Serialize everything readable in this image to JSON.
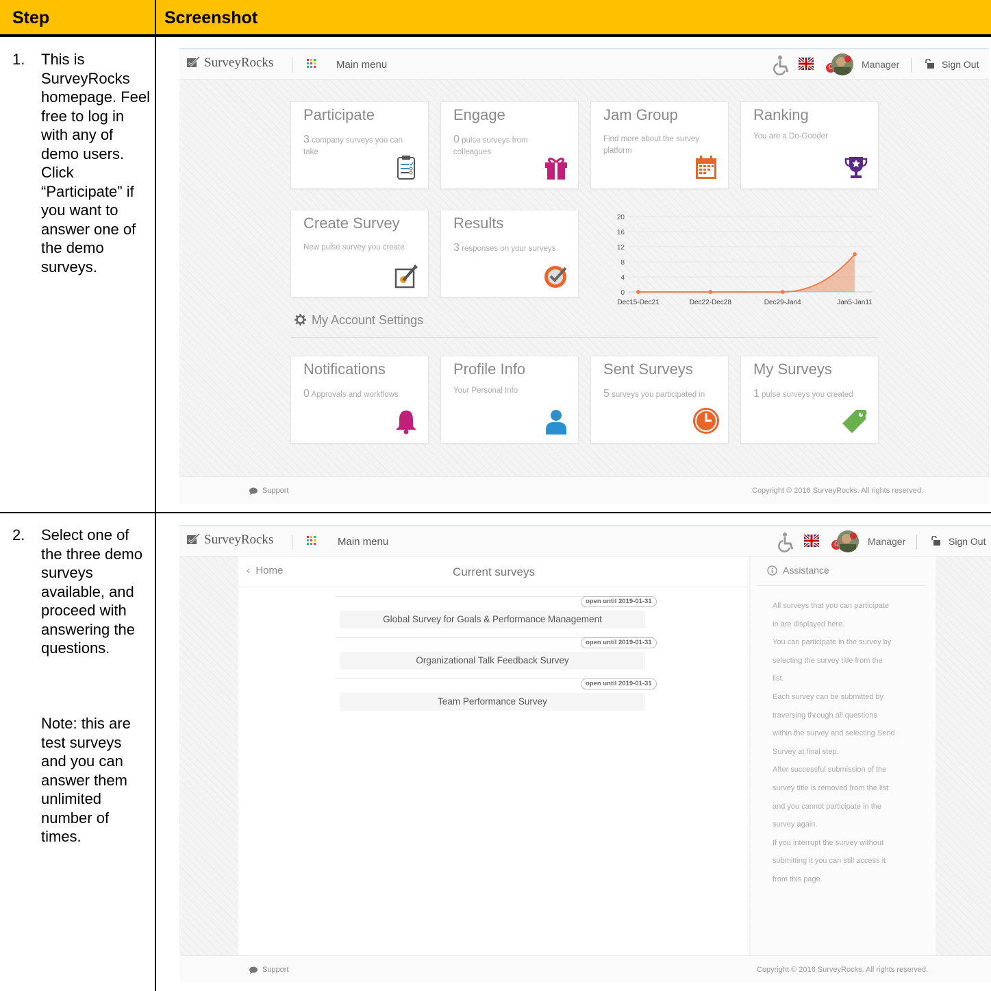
{
  "table": {
    "col_step": "Step",
    "col_screenshot": "Screenshot",
    "header_color": "#FFC000"
  },
  "steps": [
    {
      "number": "1.",
      "text": "This is SurveyRocks homepage. Feel free to log in with any of demo users. Click “Participate” if you want to answer one of the demo surveys."
    },
    {
      "number": "2.",
      "text": "Select one of the three demo surveys available, and proceed with answering the questions.",
      "note": "Note: this are test surveys and you can answer them unlimited number of times."
    }
  ],
  "app": {
    "brand": "SurveyRocks",
    "main_menu": "Main menu",
    "user": "Manager",
    "sign_out": "Sign Out",
    "notif_count": "0",
    "support": "Support",
    "copyright": "Copyright © 2016 SurveyRocks. All rights reserved.",
    "icons": [
      "brand-check-icon",
      "apps-grid-icon",
      "accessibility-icon",
      "uk-flag-icon",
      "avatar-icon",
      "sign-out-lock-icon",
      "support-chat-icon"
    ]
  },
  "home": {
    "tiles": [
      {
        "title": "Participate",
        "num": "3",
        "desc": "company surveys you can take",
        "icon": "clipboard-icon",
        "color": "#3a8fc8"
      },
      {
        "title": "Engage",
        "num": "0",
        "desc": "pulse surveys from colleagues",
        "icon": "gift-icon",
        "color": "#c0207a"
      },
      {
        "title": "Jam Group",
        "num": "",
        "desc": "Find more about the survey platform",
        "icon": "calendar-icon",
        "color": "#e8662a"
      },
      {
        "title": "Ranking",
        "num": "",
        "desc": "You are a Do-Gooder",
        "icon": "trophy-icon",
        "color": "#5b2a86"
      },
      {
        "title": "Create Survey",
        "num": "",
        "desc": "New pulse survey you create",
        "icon": "edit-icon",
        "color": "#e8a020"
      },
      {
        "title": "Results",
        "num": "3",
        "desc": "responses on your surveys",
        "icon": "check-circle-icon",
        "color": "#e8662a"
      }
    ],
    "account_heading": "My Account Settings",
    "account_tiles": [
      {
        "title": "Notifications",
        "num": "0",
        "desc": "Approvals and workflows",
        "icon": "bell-icon",
        "color": "#c0207a"
      },
      {
        "title": "Profile Info",
        "num": "",
        "desc": "Your Personal Info",
        "icon": "person-icon",
        "color": "#2a90d0"
      },
      {
        "title": "Sent Surveys",
        "num": "5",
        "desc": "surveys you participated in",
        "icon": "clock-icon",
        "color": "#e8662a"
      },
      {
        "title": "My Surveys",
        "num": "1",
        "desc": "pulse surveys you created",
        "icon": "tag-icon",
        "color": "#6ab04c"
      }
    ]
  },
  "chart_data": {
    "type": "area",
    "categories": [
      "Dec15-Dec21",
      "Dec22-Dec28",
      "Dec29-Jan4",
      "Jan5-Jan11"
    ],
    "values": [
      0,
      0,
      0,
      10
    ],
    "yticks": [
      0,
      4,
      8,
      12,
      16,
      20
    ],
    "ylim": [
      0,
      20
    ],
    "grid": true,
    "color": "#e8814a"
  },
  "surveys_page": {
    "back": "Home",
    "title": "Current surveys",
    "assistance_title": "Assistance",
    "surveys": [
      {
        "name": "Global Survey for Goals & Performance Management",
        "badge": "open until 2019-01-31"
      },
      {
        "name": "Organizational Talk Feedback Survey",
        "badge": "open until 2019-01-31"
      },
      {
        "name": "Team Performance Survey",
        "badge": "open until 2019-01-31"
      }
    ],
    "assistance_lines": [
      "All surveys that you can participate",
      "in are displayed here.",
      "You can participate in the survey by",
      "selecting the survey title from the",
      "list.",
      "Each survey can be submitted by",
      "traversing through all questions",
      "within the survey and selecting Send",
      "Survey at final step.",
      "After successful submission of the",
      "survey title is removed from the list",
      "and you cannot participate in the",
      "survey again.",
      "If you interrupt the survey without",
      "submitting it you can still access it",
      "from this page."
    ]
  }
}
